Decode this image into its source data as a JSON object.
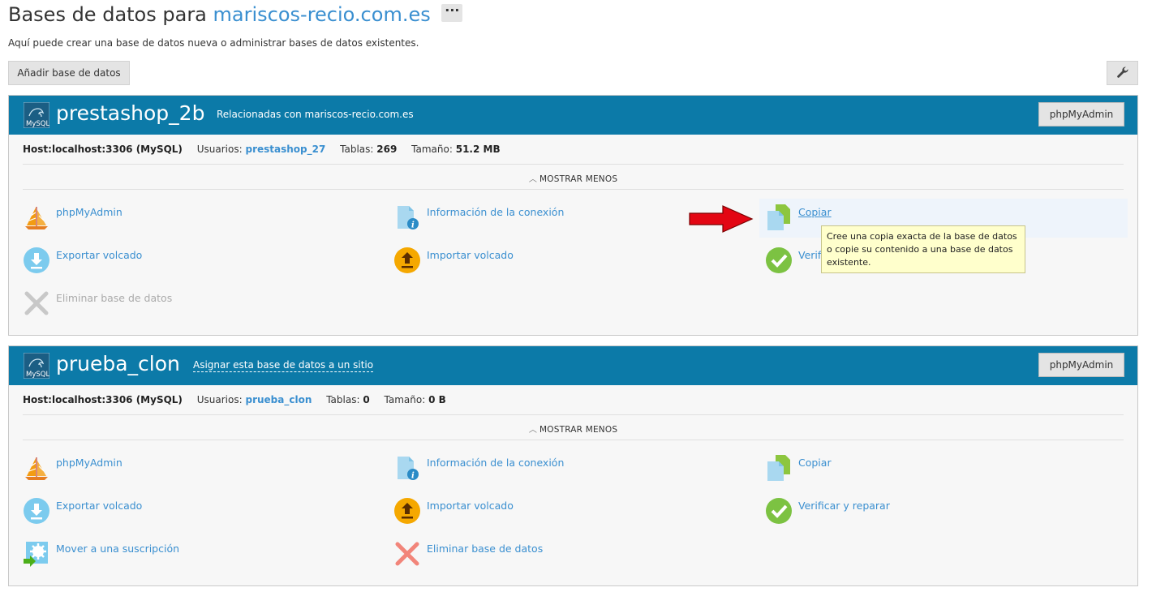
{
  "header": {
    "title_prefix": "Bases de datos para",
    "domain": "mariscos-recio.com.es",
    "more_label": "···",
    "subtitle": "Aquí puede crear una base de datos nueva o administrar bases de datos existentes."
  },
  "toolbar": {
    "add_db_label": "Añadir base de datos",
    "tools_icon": "wrench-icon"
  },
  "databases": [
    {
      "name": "prestashop_2b",
      "related": "Relacionadas con mariscos-recio.com.es",
      "pma_label": "phpMyAdmin",
      "host_label": "Host:",
      "host": "localhost:3306 (MySQL)",
      "users_label": "Usuarios:",
      "users": "prestashop_27",
      "tables_label": "Tablas:",
      "tables": "269",
      "size_label": "Tamaño:",
      "size": "51.2 MB",
      "toggle_label": "MOSTRAR MENOS",
      "actions": [
        {
          "label": "phpMyAdmin",
          "icon": "phpmyadmin-sail-icon"
        },
        {
          "label": "Información de la conexión",
          "icon": "connection-info-icon"
        },
        {
          "label": "Copiar",
          "icon": "copy-icon"
        },
        {
          "label": "Exportar volcado",
          "icon": "export-download-icon"
        },
        {
          "label": "Importar volcado",
          "icon": "import-upload-icon"
        },
        {
          "label": "Verificar y reparar",
          "icon": "check-icon"
        },
        {
          "label": "Eliminar base de datos",
          "icon": "delete-x-icon"
        }
      ]
    },
    {
      "name": "prueba_clon",
      "related": "Asignar esta base de datos a un sitio",
      "pma_label": "phpMyAdmin",
      "host_label": "Host:",
      "host": "localhost:3306 (MySQL)",
      "users_label": "Usuarios:",
      "users": "prueba_clon",
      "tables_label": "Tablas:",
      "tables": "0",
      "size_label": "Tamaño:",
      "size": "0 B",
      "toggle_label": "MOSTRAR MENOS",
      "actions": [
        {
          "label": "phpMyAdmin",
          "icon": "phpmyadmin-sail-icon"
        },
        {
          "label": "Información de la conexión",
          "icon": "connection-info-icon"
        },
        {
          "label": "Copiar",
          "icon": "copy-icon"
        },
        {
          "label": "Exportar volcado",
          "icon": "export-download-icon"
        },
        {
          "label": "Importar volcado",
          "icon": "import-upload-icon"
        },
        {
          "label": "Verificar y reparar",
          "icon": "check-icon"
        },
        {
          "label": "Mover a una suscripción",
          "icon": "move-subscription-icon"
        },
        {
          "label": "Eliminar base de datos",
          "icon": "delete-x-icon"
        }
      ]
    }
  ],
  "tooltip": {
    "text": "Cree una copia exacta de la base de datos o copie su contenido a una base de datos existente."
  },
  "colors": {
    "header_bg": "#0c7aa8",
    "link": "#3a8fd0",
    "tooltip_bg": "#ffffcc",
    "arrow": "#e30613"
  }
}
